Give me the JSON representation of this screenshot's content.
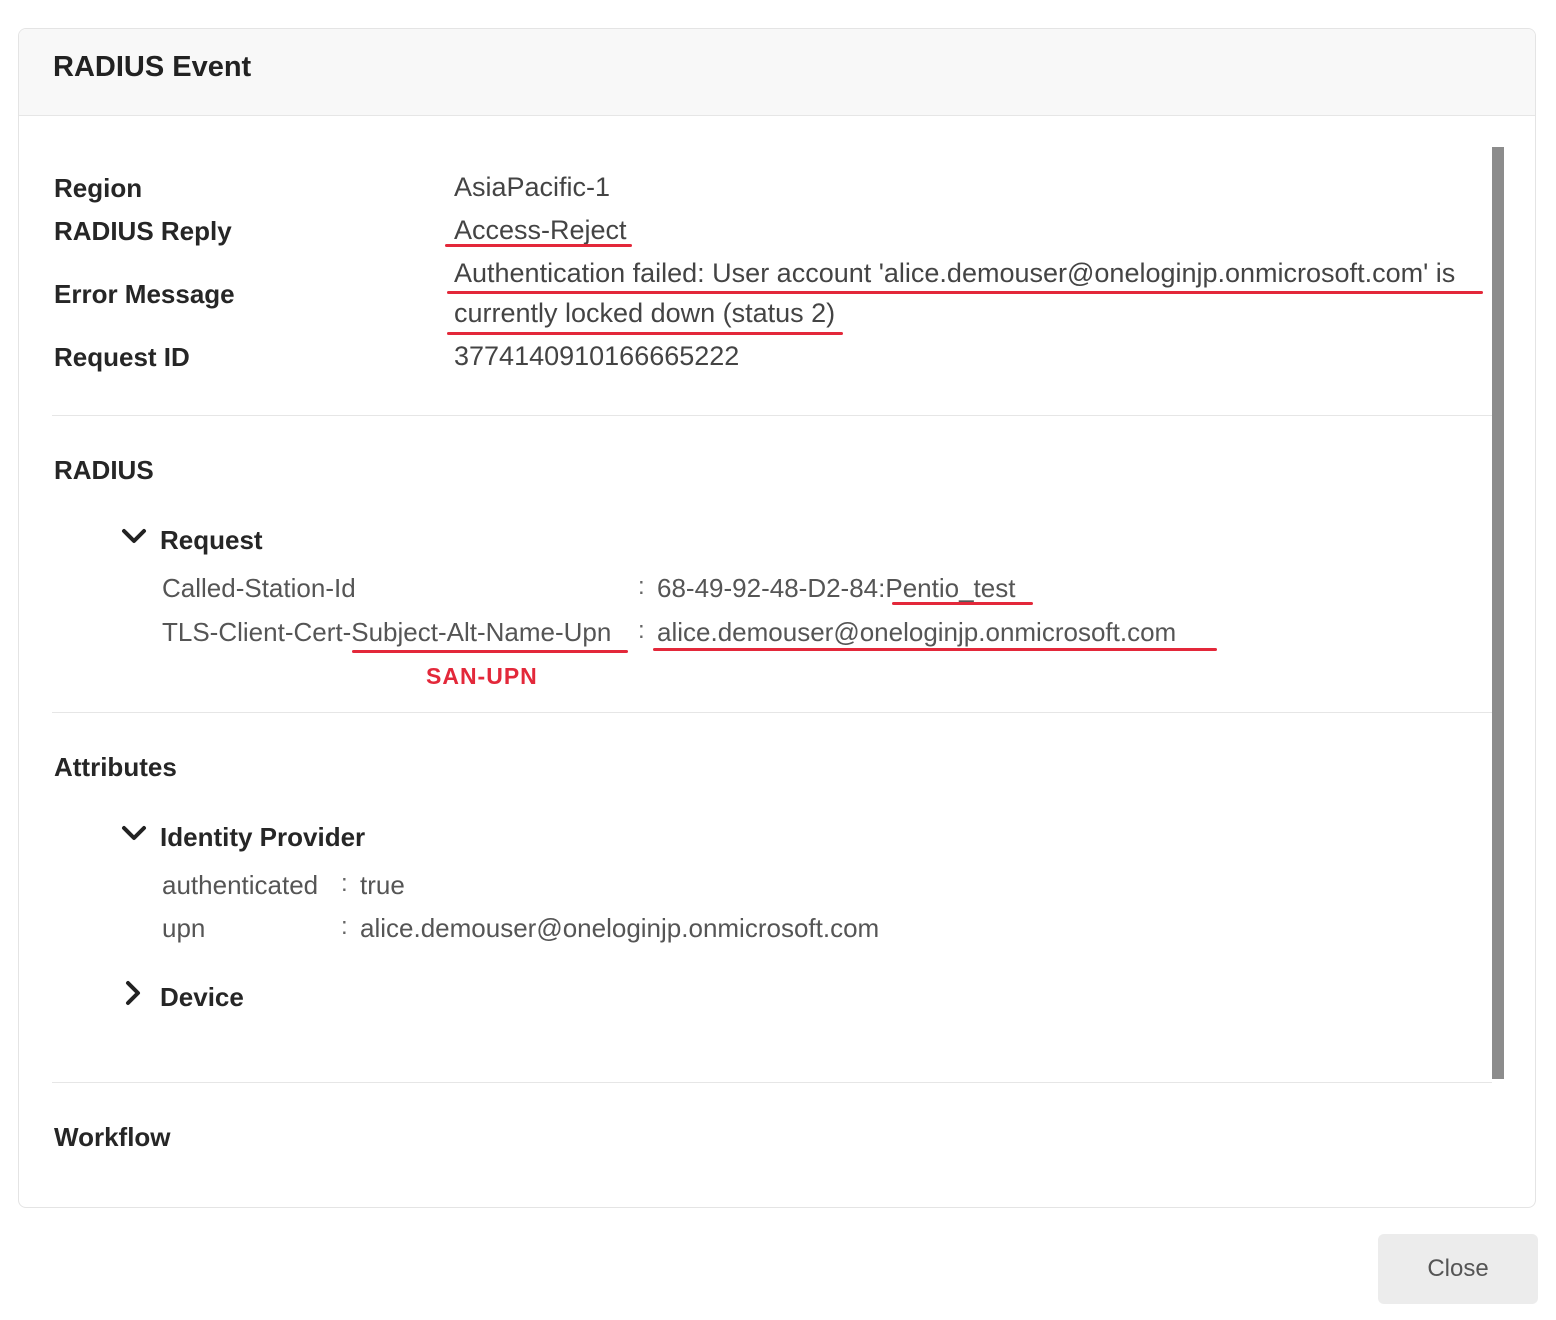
{
  "dialog": {
    "title": "RADIUS Event"
  },
  "summary": {
    "region_label": "Region",
    "region_value": "AsiaPacific-1",
    "reply_label": "RADIUS Reply",
    "reply_value": "Access-Reject",
    "error_label": "Error Message",
    "error_line1": "Authentication failed: User account 'alice.demouser@oneloginjp.onmicrosoft.com' is",
    "error_line2": "currently locked down (status 2)",
    "request_id_label": "Request ID",
    "request_id_value": "3774140910166665222"
  },
  "radius": {
    "heading": "RADIUS",
    "request": {
      "label": "Request",
      "called_station_label": "Called-Station-Id",
      "called_station_value": "68-49-92-48-D2-84:Pentio_test",
      "tls_label": "TLS-Client-Cert-Subject-Alt-Name-Upn",
      "tls_value": "alice.demouser@oneloginjp.onmicrosoft.com",
      "colon": ":"
    },
    "annotation": "SAN-UPN"
  },
  "attributes": {
    "heading": "Attributes",
    "identity_provider": {
      "label": "Identity Provider",
      "authenticated_label": "authenticated",
      "authenticated_value": "true",
      "upn_label": "upn",
      "upn_value": "alice.demouser@oneloginjp.onmicrosoft.com",
      "colon": ":"
    },
    "device": {
      "label": "Device"
    }
  },
  "workflow": {
    "heading": "Workflow"
  },
  "footer": {
    "close_label": "Close"
  },
  "colors": {
    "annotation_red": "#e3283a",
    "scrollbar": "#8c8c8c"
  },
  "icons": {
    "expanded": "chevron-down-icon",
    "collapsed": "chevron-right-icon"
  }
}
